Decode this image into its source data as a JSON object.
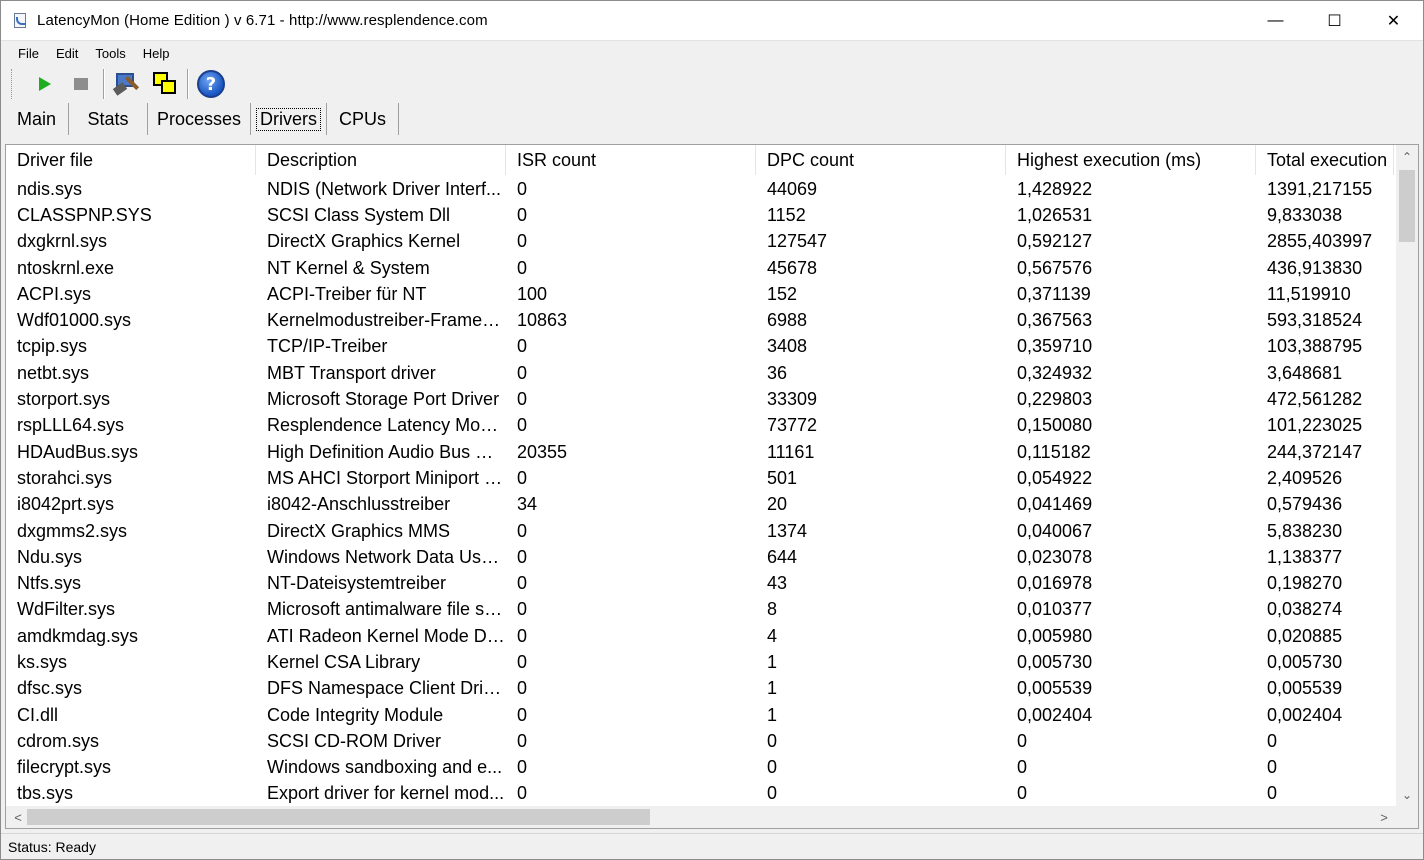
{
  "window": {
    "title": "LatencyMon  (Home Edition )  v 6.71 - http://www.resplendence.com",
    "minimize_glyph": "—",
    "maximize_glyph": "☐",
    "close_glyph": "✕"
  },
  "menu": {
    "items": [
      {
        "label": "File"
      },
      {
        "label": "Edit"
      },
      {
        "label": "Tools"
      },
      {
        "label": "Help"
      }
    ]
  },
  "toolbar": {
    "icons": [
      "play-icon",
      "stop-icon",
      "tools-icon",
      "windows-icon",
      "help-icon"
    ],
    "help_glyph": "?",
    "colors": {
      "play": "#1fae1f",
      "help": "#1a56c4"
    }
  },
  "tabs": [
    {
      "label": "Main",
      "selected": false
    },
    {
      "label": "Stats",
      "selected": false
    },
    {
      "label": "Processes",
      "selected": false
    },
    {
      "label": "Drivers",
      "selected": true
    },
    {
      "label": "CPUs",
      "selected": false
    }
  ],
  "drivers_table": {
    "columns": [
      "Driver file",
      "Description",
      "ISR count",
      "DPC count",
      "Highest execution (ms)",
      "Total execution ("
    ],
    "rows": [
      [
        "ndis.sys",
        "NDIS (Network Driver Interf...",
        "0",
        "44069",
        "1,428922",
        "1391,217155"
      ],
      [
        "CLASSPNP.SYS",
        "SCSI Class System Dll",
        "0",
        "1152",
        "1,026531",
        "9,833038"
      ],
      [
        "dxgkrnl.sys",
        "DirectX Graphics Kernel",
        "0",
        "127547",
        "0,592127",
        "2855,403997"
      ],
      [
        "ntoskrnl.exe",
        "NT Kernel & System",
        "0",
        "45678",
        "0,567576",
        "436,913830"
      ],
      [
        "ACPI.sys",
        "ACPI-Treiber für NT",
        "100",
        "152",
        "0,371139",
        "11,519910"
      ],
      [
        "Wdf01000.sys",
        "Kernelmodustreiber-Framew...",
        "10863",
        "6988",
        "0,367563",
        "593,318524"
      ],
      [
        "tcpip.sys",
        "TCP/IP-Treiber",
        "0",
        "3408",
        "0,359710",
        "103,388795"
      ],
      [
        "netbt.sys",
        "MBT Transport driver",
        "0",
        "36",
        "0,324932",
        "3,648681"
      ],
      [
        "storport.sys",
        "Microsoft Storage Port Driver",
        "0",
        "33309",
        "0,229803",
        "472,561282"
      ],
      [
        "rspLLL64.sys",
        "Resplendence Latency Monit...",
        "0",
        "73772",
        "0,150080",
        "101,223025"
      ],
      [
        "HDAudBus.sys",
        "High Definition Audio Bus Dri...",
        "20355",
        "11161",
        "0,115182",
        "244,372147"
      ],
      [
        "storahci.sys",
        "MS AHCI Storport Miniport D...",
        "0",
        "501",
        "0,054922",
        "2,409526"
      ],
      [
        "i8042prt.sys",
        "i8042-Anschlusstreiber",
        "34",
        "20",
        "0,041469",
        "0,579436"
      ],
      [
        "dxgmms2.sys",
        "DirectX Graphics MMS",
        "0",
        "1374",
        "0,040067",
        "5,838230"
      ],
      [
        "Ndu.sys",
        "Windows Network Data Usa...",
        "0",
        "644",
        "0,023078",
        "1,138377"
      ],
      [
        "Ntfs.sys",
        "NT-Dateisystemtreiber",
        "0",
        "43",
        "0,016978",
        "0,198270"
      ],
      [
        "WdFilter.sys",
        "Microsoft antimalware file sys...",
        "0",
        "8",
        "0,010377",
        "0,038274"
      ],
      [
        "amdkmdag.sys",
        "ATI Radeon Kernel Mode Dri...",
        "0",
        "4",
        "0,005980",
        "0,020885"
      ],
      [
        "ks.sys",
        "Kernel CSA Library",
        "0",
        "1",
        "0,005730",
        "0,005730"
      ],
      [
        "dfsc.sys",
        "DFS Namespace Client Driver",
        "0",
        "1",
        "0,005539",
        "0,005539"
      ],
      [
        "CI.dll",
        "Code Integrity Module",
        "0",
        "1",
        "0,002404",
        "0,002404"
      ],
      [
        "cdrom.sys",
        "SCSI CD-ROM Driver",
        "0",
        "0",
        "0",
        "0"
      ],
      [
        "filecrypt.sys",
        "Windows sandboxing and e...",
        "0",
        "0",
        "0",
        "0"
      ],
      [
        "tbs.sys",
        "Export driver for kernel mod...",
        "0",
        "0",
        "0",
        "0"
      ]
    ]
  },
  "scrollbars": {
    "up_glyph": "⌃",
    "down_glyph": "⌄",
    "left_glyph": "<",
    "right_glyph": ">"
  },
  "status": {
    "text": "Status: Ready"
  }
}
